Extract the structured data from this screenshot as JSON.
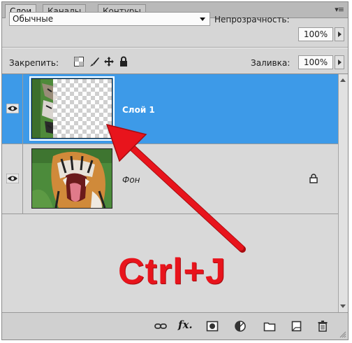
{
  "tabs": [
    {
      "label": "Слои",
      "active": true
    },
    {
      "label": "Каналы",
      "active": false
    },
    {
      "label": "Контуры",
      "active": false
    }
  ],
  "panel_menu_icon": "panel-menu-icon",
  "blend": {
    "selected": "Обычные"
  },
  "opacity": {
    "label": "Непрозрачность:",
    "value": "100%"
  },
  "lock": {
    "label": "Закрепить:",
    "icons": [
      "lock-transparency-icon",
      "lock-paint-icon",
      "lock-position-icon",
      "lock-all-icon"
    ]
  },
  "fill": {
    "label": "Заливка:",
    "value": "100%"
  },
  "layers": [
    {
      "name": "Слой 1",
      "selected": true,
      "visible": true,
      "locked": false,
      "thumbnail": "partial-tiger-on-transparent"
    },
    {
      "name": "Фон",
      "selected": false,
      "visible": true,
      "locked": true,
      "thumbnail": "tiger-photo"
    }
  ],
  "annotation": {
    "text": "Ctrl+J",
    "color": "#e8141c"
  },
  "bottom_tools": [
    "link-layers-icon",
    "fx-icon",
    "layer-mask-icon",
    "adjustment-layer-icon",
    "new-group-icon",
    "new-layer-icon",
    "trash-icon"
  ],
  "bottom_fx_label": "fx.",
  "colors": {
    "selection": "#3d9ae8",
    "panel": "#d6d6d6",
    "arrow": "#e8141c"
  }
}
